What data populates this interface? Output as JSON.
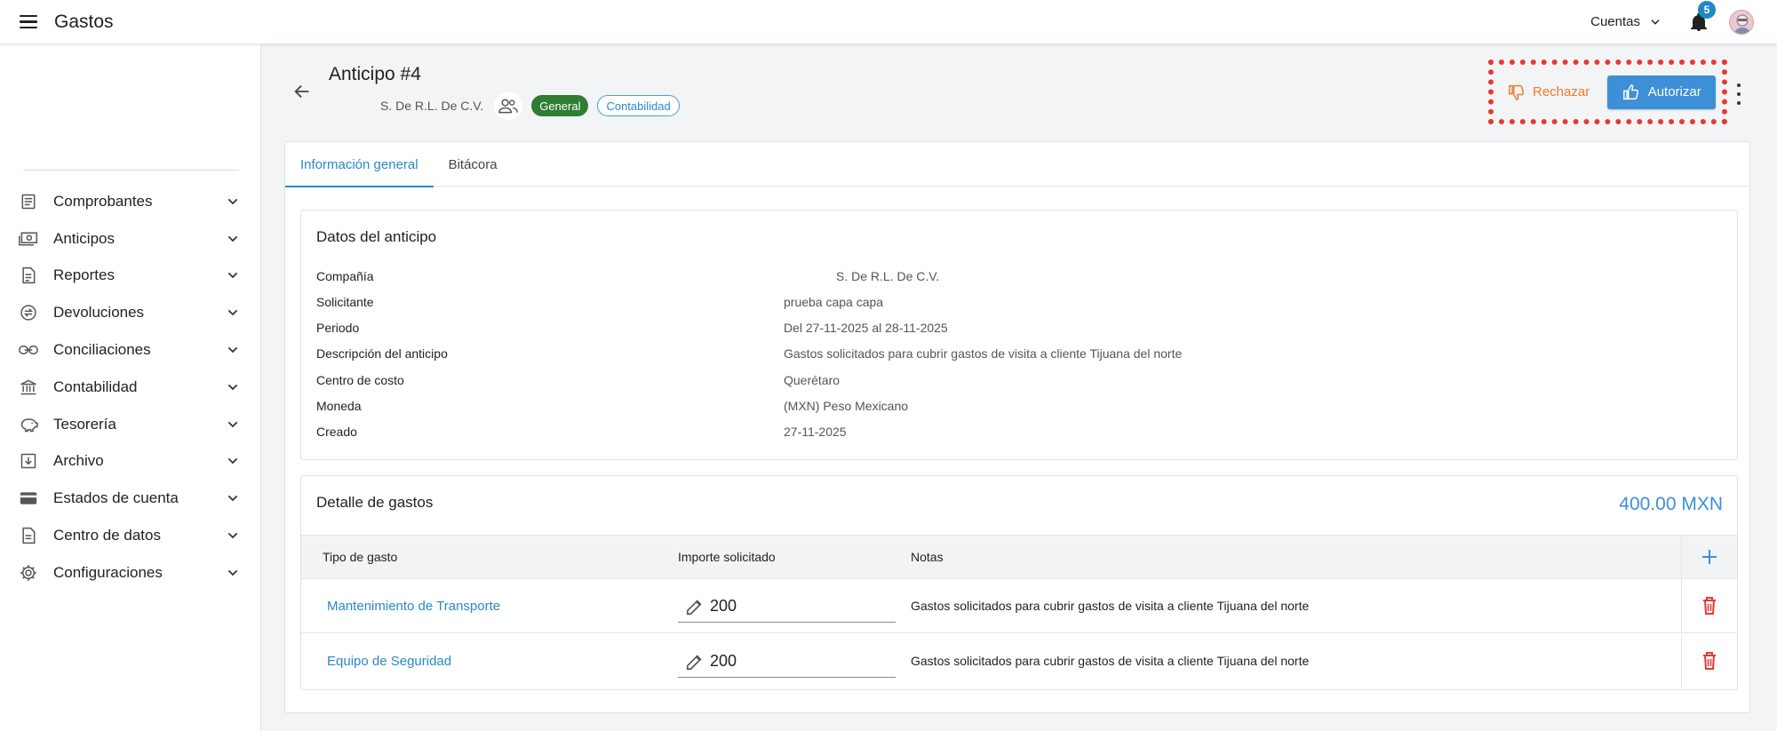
{
  "app": {
    "title": "Gastos"
  },
  "topbar": {
    "accounts_label": "Cuentas",
    "notifications_count": "5"
  },
  "sidebar": {
    "items": [
      {
        "label": "Comprobantes",
        "icon": "receipt-icon"
      },
      {
        "label": "Anticipos",
        "icon": "cash-icon"
      },
      {
        "label": "Reportes",
        "icon": "report-icon"
      },
      {
        "label": "Devoluciones",
        "icon": "refund-icon"
      },
      {
        "label": "Conciliaciones",
        "icon": "link-icon"
      },
      {
        "label": "Contabilidad",
        "icon": "bank-icon"
      },
      {
        "label": "Tesorería",
        "icon": "piggy-bank-icon"
      },
      {
        "label": "Archivo",
        "icon": "archive-icon"
      },
      {
        "label": "Estados de cuenta",
        "icon": "card-icon"
      },
      {
        "label": "Centro de datos",
        "icon": "data-icon"
      },
      {
        "label": "Configuraciones",
        "icon": "gear-icon"
      }
    ]
  },
  "header": {
    "title": "Anticipo #4",
    "company": "S. De R.L. De C.V.",
    "chip_general": "General",
    "chip_accounting": "Contabilidad",
    "reject_label": "Rechazar",
    "authorize_label": "Autorizar"
  },
  "tabs": [
    {
      "label": "Información general",
      "active": true
    },
    {
      "label": "Bitácora",
      "active": false
    }
  ],
  "advance_data": {
    "title": "Datos del anticipo",
    "rows": [
      {
        "label": "Compañía",
        "value": "S. De R.L. De C.V."
      },
      {
        "label": "Solicitante",
        "value": "prueba capa capa"
      },
      {
        "label": "Periodo",
        "value": "Del 27-11-2025 al 28-11-2025"
      },
      {
        "label": "Descripción del anticipo",
        "value": "Gastos solicitados para cubrir gastos de visita a cliente Tijuana del norte"
      },
      {
        "label": "Centro de costo",
        "value": "Querétaro"
      },
      {
        "label": "Moneda",
        "value": "(MXN) Peso Mexicano"
      },
      {
        "label": "Creado",
        "value": "27-11-2025"
      }
    ]
  },
  "expenses": {
    "title": "Detalle de gastos",
    "total": "400.00 MXN",
    "columns": [
      "Tipo de gasto",
      "Importe solicitado",
      "Notas"
    ],
    "rows": [
      {
        "type": "Mantenimiento de Transporte",
        "amount": "200",
        "notes": "Gastos solicitados para cubrir gastos de visita a cliente Tijuana del norte"
      },
      {
        "type": "Equipo de Seguridad",
        "amount": "200",
        "notes": "Gastos solicitados para cubrir gastos de visita a cliente Tijuana del norte"
      }
    ]
  },
  "colors": {
    "primary": "#3d8fd6",
    "link": "#2b88c9",
    "reject": "#ef7b2e",
    "general_chip": "#2e7d32",
    "delete": "#e53935",
    "highlight": "#e53935"
  }
}
